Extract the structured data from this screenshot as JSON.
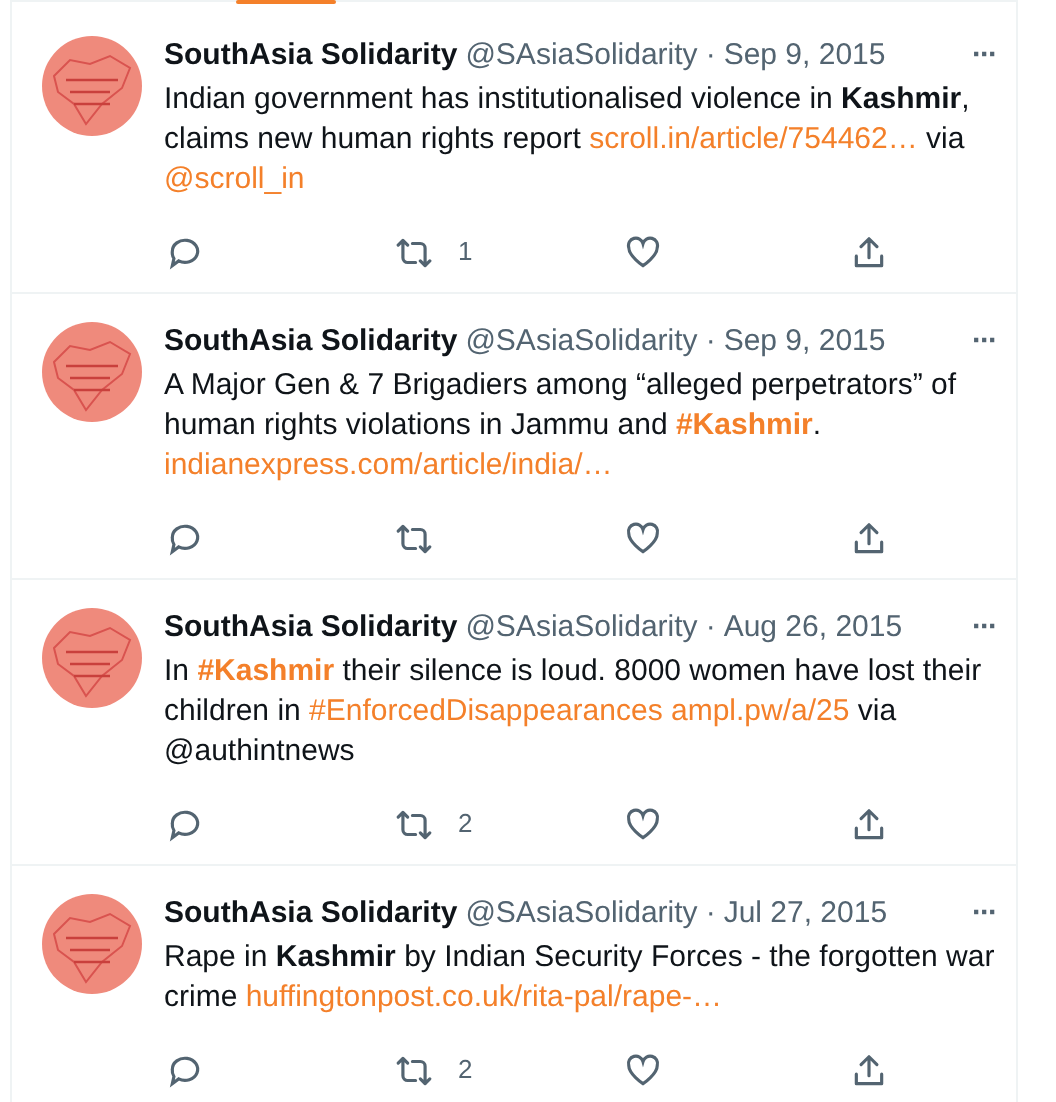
{
  "separator": "·",
  "tweets": [
    {
      "name": "SouthAsia Solidarity",
      "handle": "@SAsiaSolidarity",
      "date": "Sep 9, 2015",
      "more": "···",
      "retweets": "1",
      "body": [
        {
          "kind": "text",
          "text": "Indian government has institutionalised violence in **Kashmir**, claims new human rights report "
        },
        {
          "kind": "link",
          "text": "scroll.in/article/754462…"
        },
        {
          "kind": "text",
          "text": " via "
        },
        {
          "kind": "link",
          "text": "@scroll_in"
        }
      ]
    },
    {
      "name": "SouthAsia Solidarity",
      "handle": "@SAsiaSolidarity",
      "date": "Sep 9, 2015",
      "more": "···",
      "body": [
        {
          "kind": "text",
          "text": "A Major Gen & 7 Brigadiers among  “alleged perpetrators” of human rights violations in Jammu and "
        },
        {
          "kind": "hashtag",
          "text": "#Kashmir"
        },
        {
          "kind": "text",
          "text": ". "
        },
        {
          "kind": "link",
          "text": "indianexpress.com/article/india/…"
        }
      ]
    },
    {
      "name": "SouthAsia Solidarity",
      "handle": "@SAsiaSolidarity",
      "date": "Aug 26, 2015",
      "more": "···",
      "retweets": "2",
      "body": [
        {
          "kind": "text",
          "text": "In "
        },
        {
          "kind": "hashtag",
          "text": "#Kashmir"
        },
        {
          "kind": "text",
          "text": " their silence is loud. 8000 women have lost their children in  "
        },
        {
          "kind": "link",
          "text": "#EnforcedDisappearances "
        },
        {
          "kind": "link",
          "text": "ampl.pw/a/25"
        },
        {
          "kind": "text",
          "text": " via @authintnews"
        }
      ]
    },
    {
      "name": "SouthAsia Solidarity",
      "handle": "@SAsiaSolidarity",
      "date": "Jul 27, 2015",
      "more": "···",
      "retweets": "2",
      "body": [
        {
          "kind": "text",
          "text": "Rape in **Kashmir** by Indian Security Forces - the forgotten war crime "
        },
        {
          "kind": "link",
          "text": "huffingtonpost.co.uk/rita-pal/rape-…"
        }
      ]
    }
  ]
}
